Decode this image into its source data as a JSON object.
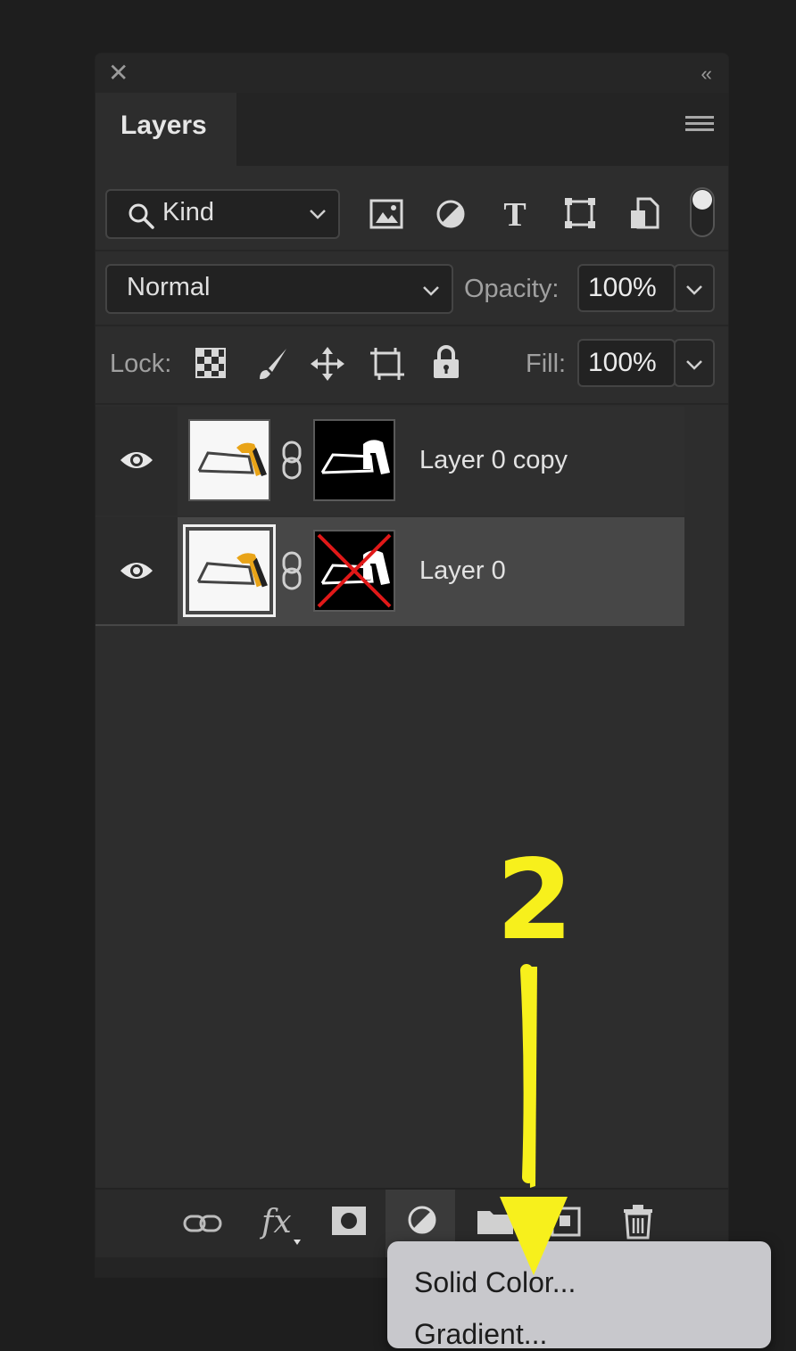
{
  "panel": {
    "tab_title": "Layers",
    "filter": {
      "kind_label": "Kind"
    },
    "blend": {
      "mode": "Normal",
      "opacity_label": "Opacity:",
      "opacity_value": "100%"
    },
    "lock": {
      "lock_label": "Lock:",
      "fill_label": "Fill:",
      "fill_value": "100%"
    },
    "layers": [
      {
        "name": "Layer 0 copy",
        "visible": true,
        "mask_disabled": false,
        "selected": false
      },
      {
        "name": "Layer 0",
        "visible": true,
        "mask_disabled": true,
        "selected": true
      }
    ]
  },
  "annotation": {
    "step_number": "2",
    "color": "#f7f01c"
  },
  "context_menu": {
    "items": [
      "Solid Color...",
      "Gradient..."
    ]
  },
  "icons": {
    "filter_icons": [
      "image-filter-icon",
      "adjustment-filter-icon",
      "type-filter-icon",
      "shape-filter-icon",
      "smart-object-filter-icon"
    ],
    "lock_icons": [
      "lock-transparent-icon",
      "lock-paint-icon",
      "lock-position-icon",
      "lock-artboard-icon",
      "lock-all-icon"
    ],
    "bottom_icons": [
      "link-layers-icon",
      "fx-icon",
      "add-mask-icon",
      "adjustment-layer-icon",
      "new-group-icon",
      "new-layer-icon",
      "delete-icon"
    ]
  }
}
